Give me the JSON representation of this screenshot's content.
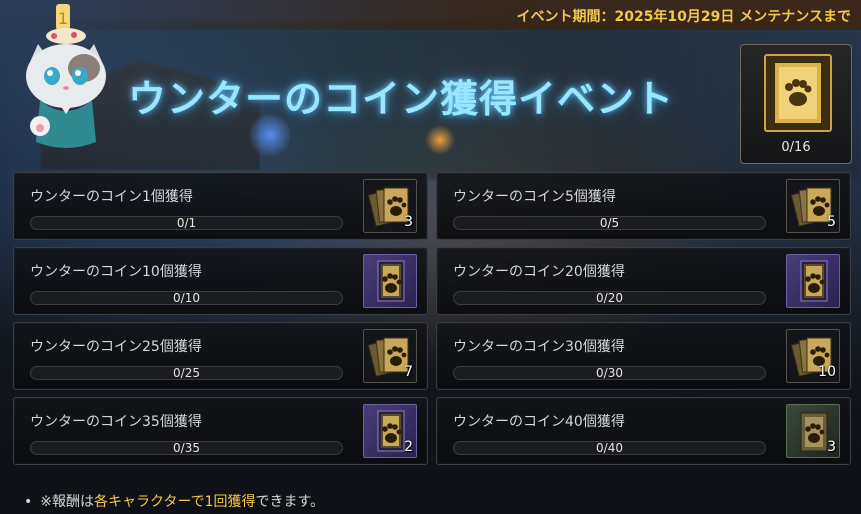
{
  "header": {
    "event_period": "イベント期間：2025年10月29日 メンテナンスまで",
    "title": "ウンターのコイン獲得イベント"
  },
  "total": {
    "count_text": "0/16",
    "icon": "paw-coin-card-gold-icon"
  },
  "missions": [
    {
      "label": "ウンターのコイン1個獲得",
      "progress_text": "0/1",
      "progress": 0,
      "reward_icon": "paw-card-stack-icon",
      "reward_style": "dark",
      "reward_qty": "3"
    },
    {
      "label": "ウンターのコイン5個獲得",
      "progress_text": "0/5",
      "progress": 0,
      "reward_icon": "paw-card-stack-icon",
      "reward_style": "dark",
      "reward_qty": "5"
    },
    {
      "label": "ウンターのコイン10個獲得",
      "progress_text": "0/10",
      "progress": 0,
      "reward_icon": "paw-card-purple-icon",
      "reward_style": "purple",
      "reward_qty": ""
    },
    {
      "label": "ウンターのコイン20個獲得",
      "progress_text": "0/20",
      "progress": 0,
      "reward_icon": "paw-card-purple-icon",
      "reward_style": "purple",
      "reward_qty": ""
    },
    {
      "label": "ウンターのコイン25個獲得",
      "progress_text": "0/25",
      "progress": 0,
      "reward_icon": "paw-card-stack-icon",
      "reward_style": "dark",
      "reward_qty": "7"
    },
    {
      "label": "ウンターのコイン30個獲得",
      "progress_text": "0/30",
      "progress": 0,
      "reward_icon": "paw-card-stack-icon",
      "reward_style": "dark",
      "reward_qty": "10"
    },
    {
      "label": "ウンターのコイン35個獲得",
      "progress_text": "0/35",
      "progress": 0,
      "reward_icon": "paw-card-purple-icon",
      "reward_style": "purple",
      "reward_qty": "2"
    },
    {
      "label": "ウンターのコイン40個獲得",
      "progress_text": "0/40",
      "progress": 0,
      "reward_icon": "paw-card-green-icon",
      "reward_style": "green",
      "reward_qty": "3"
    }
  ],
  "footer": {
    "bullet": "•",
    "prefix": "※報酬は",
    "highlight": "各キャラクターで1回獲得",
    "suffix": "できます。"
  }
}
